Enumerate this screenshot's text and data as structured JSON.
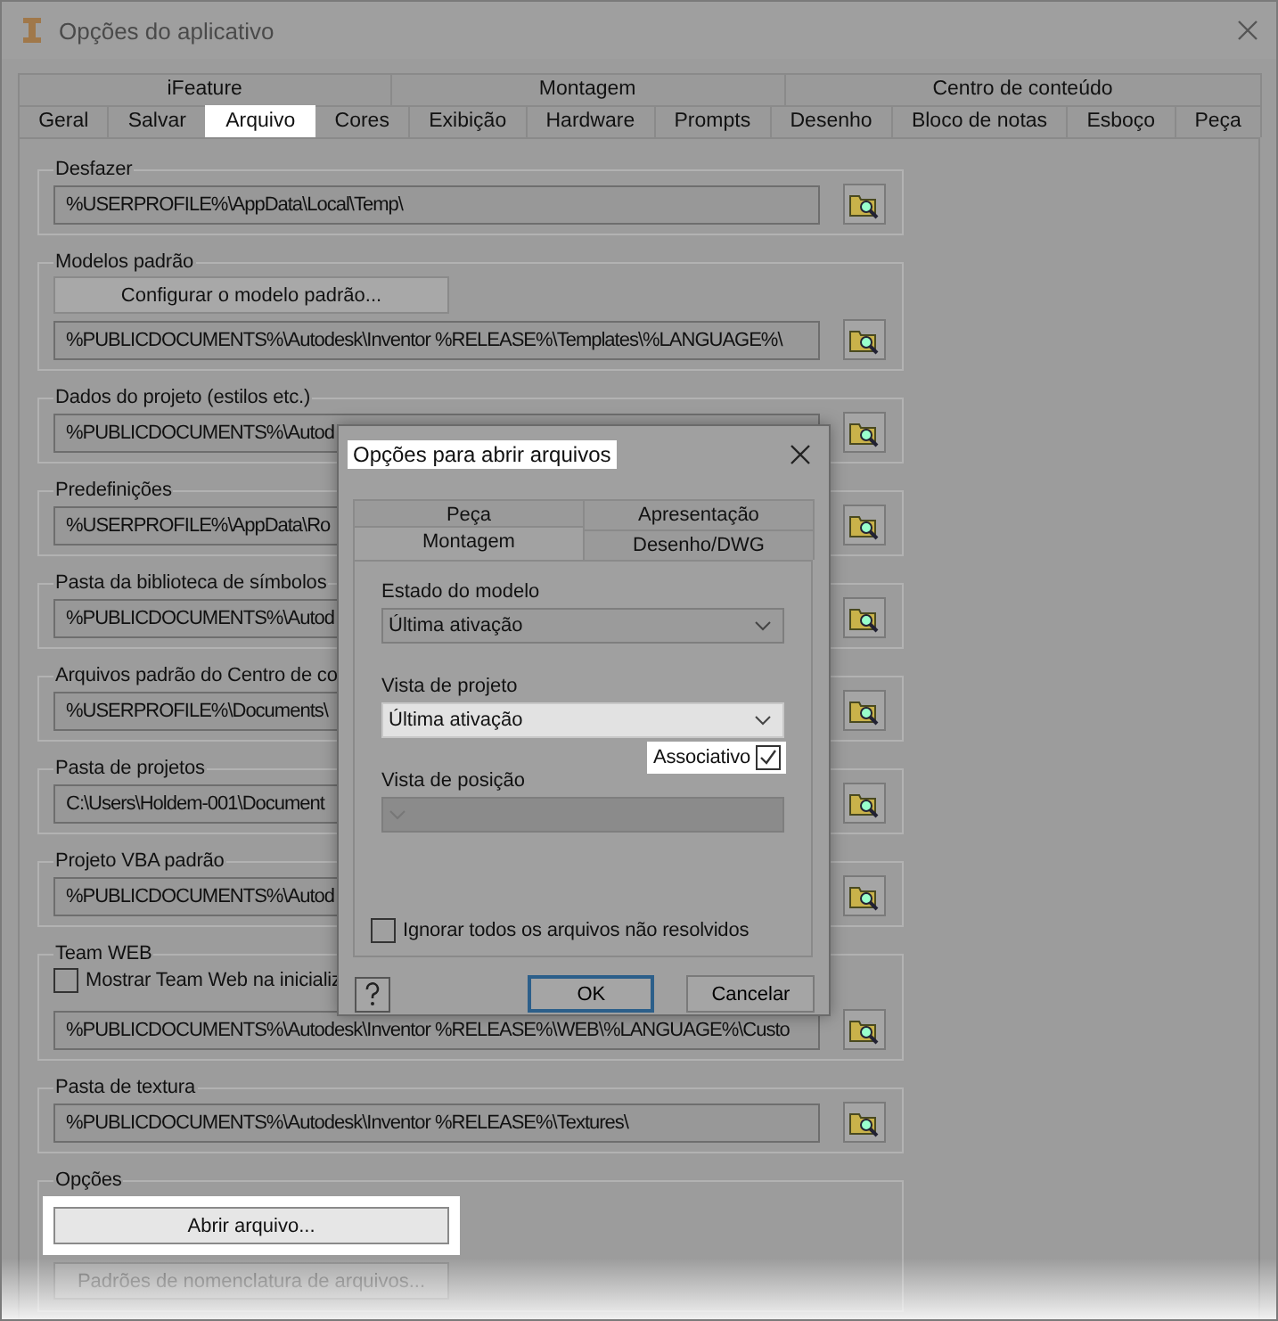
{
  "window": {
    "title": "Opções do aplicativo"
  },
  "tab_rows": [
    [
      {
        "label": "iFeature",
        "selected": false
      },
      {
        "label": "Montagem",
        "selected": false
      },
      {
        "label": "Centro de conteúdo",
        "selected": false
      }
    ],
    [
      {
        "label": "Geral",
        "selected": false
      },
      {
        "label": "Salvar",
        "selected": false
      },
      {
        "label": "Arquivo",
        "selected": true
      },
      {
        "label": "Cores",
        "selected": false
      },
      {
        "label": "Exibição",
        "selected": false
      },
      {
        "label": "Hardware",
        "selected": false
      },
      {
        "label": "Prompts",
        "selected": false
      },
      {
        "label": "Desenho",
        "selected": false
      },
      {
        "label": "Bloco de notas",
        "selected": false
      },
      {
        "label": "Esboço",
        "selected": false
      },
      {
        "label": "Peça",
        "selected": false
      }
    ]
  ],
  "groups": [
    {
      "label": "Desfazer",
      "path": "%USERPROFILE%\\AppData\\Local\\Temp\\"
    },
    {
      "label": "Modelos padrão",
      "button": "Configurar o modelo padrão...",
      "path": "%PUBLICDOCUMENTS%\\Autodesk\\Inventor %RELEASE%\\Templates\\%LANGUAGE%\\"
    },
    {
      "label": "Dados do projeto (estilos etc.)",
      "path": "%PUBLICDOCUMENTS%\\Autod"
    },
    {
      "label": "Predefinições",
      "path": "%USERPROFILE%\\AppData\\Ro"
    },
    {
      "label": "Pasta da biblioteca de símbolos",
      "path": "%PUBLICDOCUMENTS%\\Autod"
    },
    {
      "label": "Arquivos padrão do Centro de co",
      "path": "%USERPROFILE%\\Documents\\"
    },
    {
      "label": "Pasta de projetos",
      "path": "C:\\Users\\Holdem-001\\Document"
    },
    {
      "label": "Projeto VBA padrão",
      "path": "%PUBLICDOCUMENTS%\\Autod"
    },
    {
      "label": "Team WEB",
      "checkbox": {
        "label": "Mostrar Team Web na inicializ",
        "checked": false
      },
      "path": "%PUBLICDOCUMENTS%\\Autodesk\\Inventor %RELEASE%\\WEB\\%LANGUAGE%\\Custo"
    },
    {
      "label": "Pasta de textura",
      "path": "%PUBLICDOCUMENTS%\\Autodesk\\Inventor %RELEASE%\\Textures\\"
    }
  ],
  "options": {
    "label": "Opções",
    "buttons": [
      {
        "label": "Abrir arquivo...",
        "highlighted": true,
        "disabled": false
      },
      {
        "label": "Padrões de nomenclatura de arquivos...",
        "highlighted": false,
        "disabled": true
      }
    ]
  },
  "dialog": {
    "title": "Opções para abrir arquivos",
    "title_highlighted": true,
    "tab_rows": [
      [
        {
          "label": "Peça",
          "selected": false
        },
        {
          "label": "Apresentação",
          "selected": false
        }
      ],
      [
        {
          "label": "Montagem",
          "selected": true
        },
        {
          "label": "Desenho/DWG",
          "selected": false
        }
      ]
    ],
    "fields": [
      {
        "label": "Estado do modelo",
        "value": "Última ativação",
        "focused": false,
        "disabled": false
      },
      {
        "label": "Vista de projeto",
        "value": "Última ativação",
        "focused": true,
        "disabled": false
      },
      {
        "label": "Vista de posição",
        "focused": false,
        "disabled": true
      }
    ],
    "associative": {
      "label": "Associativo",
      "checked": true,
      "highlighted": true
    },
    "ignore": {
      "label": "Ignorar todos os arquivos não resolvidos",
      "checked": false
    },
    "buttons": [
      {
        "label": "OK",
        "default": true
      },
      {
        "label": "Cancelar",
        "default": false
      }
    ]
  }
}
